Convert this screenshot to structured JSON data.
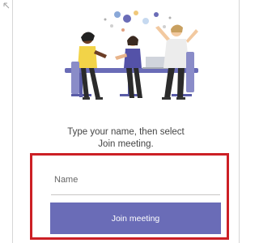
{
  "prompt": {
    "line1": "Type your name, then select",
    "line2": "Join meeting."
  },
  "name_field": {
    "placeholder": "Name",
    "value": ""
  },
  "join_button": {
    "label": "Join meeting"
  },
  "colors": {
    "accent": "#6a6cb7",
    "highlight_border": "#cc1f25",
    "prompt_text": "#444444"
  },
  "icons": {
    "corner": "back-arrow-icon",
    "hero": "meeting-people-illustration"
  }
}
